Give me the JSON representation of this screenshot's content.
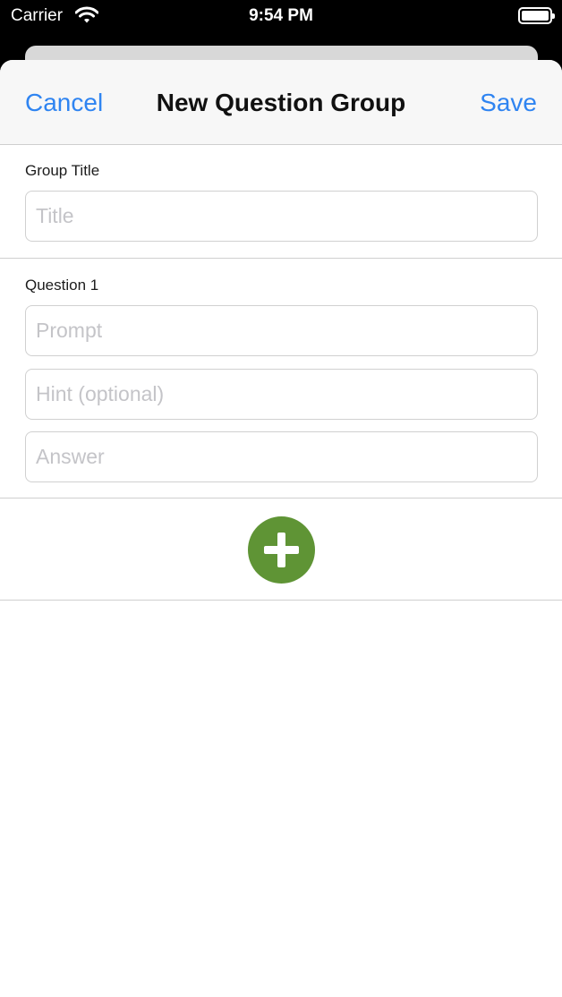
{
  "status_bar": {
    "carrier": "Carrier",
    "time": "9:54 PM"
  },
  "nav": {
    "cancel_label": "Cancel",
    "title": "New Question Group",
    "save_label": "Save"
  },
  "group": {
    "label": "Group Title",
    "title_placeholder": "Title",
    "title_value": ""
  },
  "question": {
    "label": "Question 1",
    "prompt_placeholder": "Prompt",
    "hint_placeholder": "Hint (optional)",
    "answer_placeholder": "Answer"
  },
  "icons": {
    "add": "plus-circle-icon",
    "wifi": "wifi-icon",
    "battery": "battery-icon"
  },
  "colors": {
    "accent": "#2f84f1",
    "add_button": "#5f9435"
  }
}
